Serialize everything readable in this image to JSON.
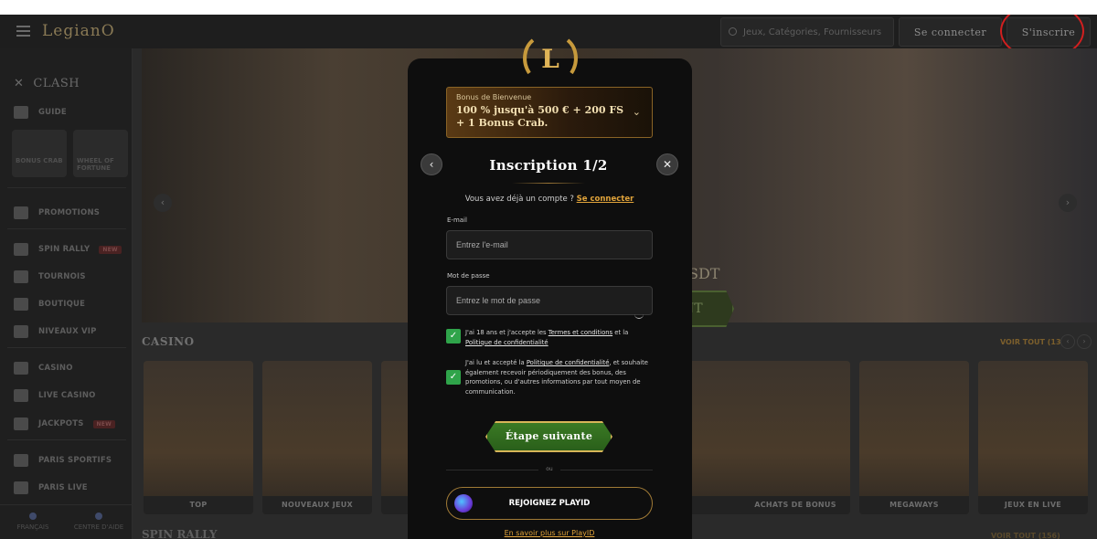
{
  "header": {
    "logo": "LegianO",
    "search_placeholder": "Jeux, Catégories, Fournisseurs",
    "login_label": "Se connecter",
    "signup_label": "S'inscrire"
  },
  "sidebar": {
    "clash_label": "CLASH",
    "guide_label": "GUIDE",
    "tiles": [
      "BONUS CRAB",
      "WHEEL OF FORTUNE"
    ],
    "items": [
      {
        "label": "PROMOTIONS"
      },
      {
        "label": "SPIN RALLY",
        "badge": "NEW"
      },
      {
        "label": "TOURNOIS"
      },
      {
        "label": "BOUTIQUE"
      },
      {
        "label": "NIVEAUX VIP"
      },
      {
        "label": "CASINO"
      },
      {
        "label": "LIVE CASINO"
      },
      {
        "label": "JACKPOTS",
        "badge": "NEW"
      },
      {
        "label": "PARIS SPORTIFS"
      },
      {
        "label": "PARIS LIVE"
      }
    ],
    "language_label": "FRANÇAIS",
    "help_label": "CENTRE D'AIDE"
  },
  "hero": {
    "partial_text": "SDT",
    "partial_button": "NT"
  },
  "casino_section": {
    "title": "CASINO",
    "see_all": "VOIR TOUT (13)",
    "cards": [
      "TOP",
      "NOUVEAUX JEUX",
      "",
      "",
      "",
      "ACHATS DE BONUS",
      "MEGAWAYS",
      "JEUX EN LIVE"
    ]
  },
  "spin_section": {
    "title": "SPIN RALLY",
    "see_all": "VOIR TOUT (156)"
  },
  "modal": {
    "bonus_small": "Bonus de Bienvenue",
    "bonus_big": "100 % jusqu'à 500 € + 200 FS + 1 Bonus Crab.",
    "title": "Inscription 1/2",
    "have_account": "Vous avez déjà un compte ?",
    "login_link": "Se connecter",
    "email_label": "E-mail",
    "email_placeholder": "Entrez l'e-mail",
    "password_label": "Mot de passe",
    "password_placeholder": "Entrez le mot de passe",
    "consent1_a": "J'ai 18 ans et j'accepte les ",
    "consent1_terms": "Termes et conditions",
    "consent1_b": " et la ",
    "consent1_privacy": "Politique de confidentialité",
    "consent2_a": "J'ai lu et accepté la ",
    "consent2_privacy": "Politique de confidentialité",
    "consent2_b": ", et souhaite également recevoir périodiquement des bonus, des promotions, ou d'autres informations par tout moyen de communication.",
    "next_label": "Étape suivante",
    "or_label": "ou",
    "playid_label": "REJOIGNEZ PLAYID",
    "learn_more": "En savoir plus sur PlayID"
  }
}
